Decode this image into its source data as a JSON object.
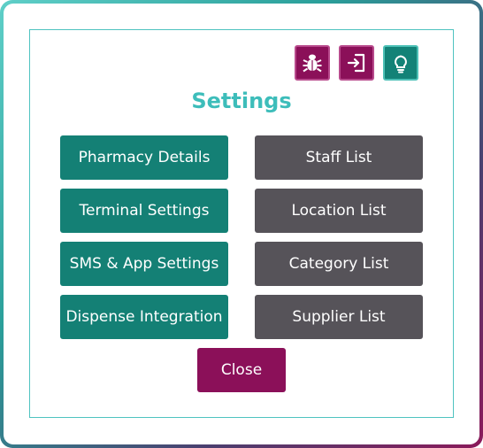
{
  "title": "Settings",
  "toolbar": {
    "bug_icon": "bug-icon",
    "exit_icon": "sign-in-icon",
    "help_icon": "lightbulb-icon"
  },
  "buttons": {
    "pharmacy_details": "Pharmacy Details",
    "terminal_settings": "Terminal Settings",
    "sms_app_settings": "SMS & App Settings",
    "dispense_integration": "Dispense Integration",
    "staff_list": "Staff List",
    "location_list": "Location List",
    "category_list": "Category List",
    "supplier_list": "Supplier List",
    "close": "Close"
  },
  "colors": {
    "teal": "#148075",
    "grey": "#565359",
    "plum": "#8b1059",
    "title": "#3dbdba"
  }
}
